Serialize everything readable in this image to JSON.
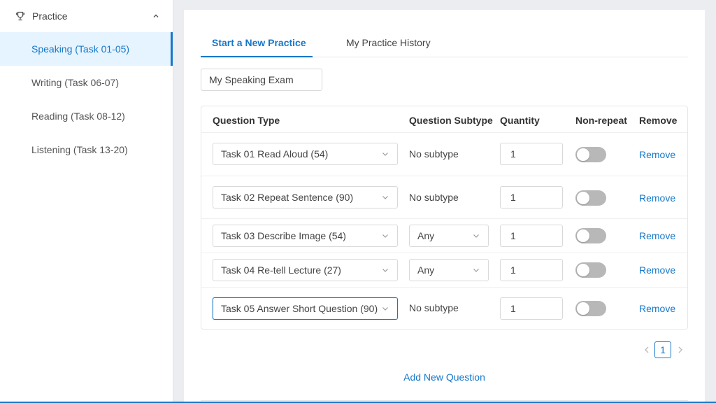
{
  "sidebar": {
    "group_label": "Practice",
    "items": [
      {
        "label": "Speaking (Task 01-05)"
      },
      {
        "label": "Writing (Task 06-07)"
      },
      {
        "label": "Reading (Task 08-12)"
      },
      {
        "label": "Listening (Task 13-20)"
      }
    ],
    "active_index": 0
  },
  "tabs": [
    {
      "label": "Start a New Practice",
      "active": true
    },
    {
      "label": "My Practice History",
      "active": false
    }
  ],
  "exam_name": {
    "value": "My Speaking Exam"
  },
  "table": {
    "headers": {
      "type": "Question Type",
      "subtype": "Question Subtype",
      "quantity": "Quantity",
      "nonrepeat": "Non-repeat",
      "remove": "Remove"
    },
    "rows": [
      {
        "type": "Task 01 Read Aloud (54)",
        "subtype": "No subtype",
        "subtype_is_select": false,
        "quantity": "1",
        "nonrepeat": false,
        "remove": "Remove"
      },
      {
        "type": "Task 02 Repeat Sentence (90)",
        "subtype": "No subtype",
        "subtype_is_select": false,
        "quantity": "1",
        "nonrepeat": false,
        "remove": "Remove"
      },
      {
        "type": "Task 03 Describe Image (54)",
        "subtype": "Any",
        "subtype_is_select": true,
        "quantity": "1",
        "nonrepeat": false,
        "remove": "Remove"
      },
      {
        "type": "Task 04 Re-tell Lecture (27)",
        "subtype": "Any",
        "subtype_is_select": true,
        "quantity": "1",
        "nonrepeat": false,
        "remove": "Remove"
      },
      {
        "type": "Task 05 Answer Short Question (90)",
        "subtype": "No subtype",
        "subtype_is_select": false,
        "quantity": "1",
        "nonrepeat": false,
        "remove": "Remove"
      }
    ]
  },
  "pagination": {
    "current": "1"
  },
  "add_question_label": "Add New Question",
  "colors": {
    "accent": "#1677c9",
    "active_bg": "#e6f4ff",
    "toggle_off": "#b8b8b8"
  },
  "icons": {
    "group": "trophy-icon",
    "collapse": "chevron-up-icon",
    "select": "chevron-down-icon"
  }
}
